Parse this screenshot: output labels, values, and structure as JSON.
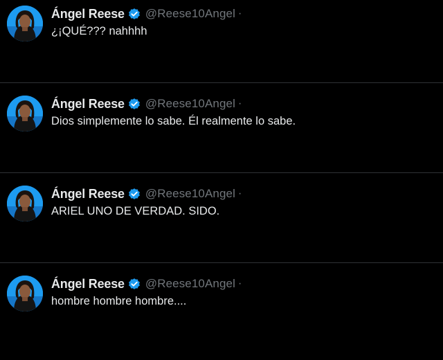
{
  "theme": {
    "background": "#000000",
    "divider": "#2f3336",
    "text_primary": "#e7e9ea",
    "text_secondary": "#71767b",
    "verified_badge": "#1d9bf0"
  },
  "tweets": [
    {
      "author": {
        "name": "Ángel Reese",
        "handle": "@Reese10Angel",
        "separator": "·",
        "avatar": "avatar-photo",
        "verified_icon": "verified-badge-icon"
      },
      "text": "¿¡QUÉ??? nahhhh"
    },
    {
      "author": {
        "name": "Ángel Reese",
        "handle": "@Reese10Angel",
        "separator": "·",
        "avatar": "avatar-photo",
        "verified_icon": "verified-badge-icon"
      },
      "text": "Dios simplemente lo sabe. Él realmente lo sabe."
    },
    {
      "author": {
        "name": "Ángel Reese",
        "handle": "@Reese10Angel",
        "separator": "·",
        "avatar": "avatar-photo",
        "verified_icon": "verified-badge-icon"
      },
      "text": "ARIEL UNO DE VERDAD. SIDO."
    },
    {
      "author": {
        "name": "Ángel Reese",
        "handle": "@Reese10Angel",
        "separator": "·",
        "avatar": "avatar-photo",
        "verified_icon": "verified-badge-icon"
      },
      "text": "hombre hombre hombre...."
    }
  ]
}
